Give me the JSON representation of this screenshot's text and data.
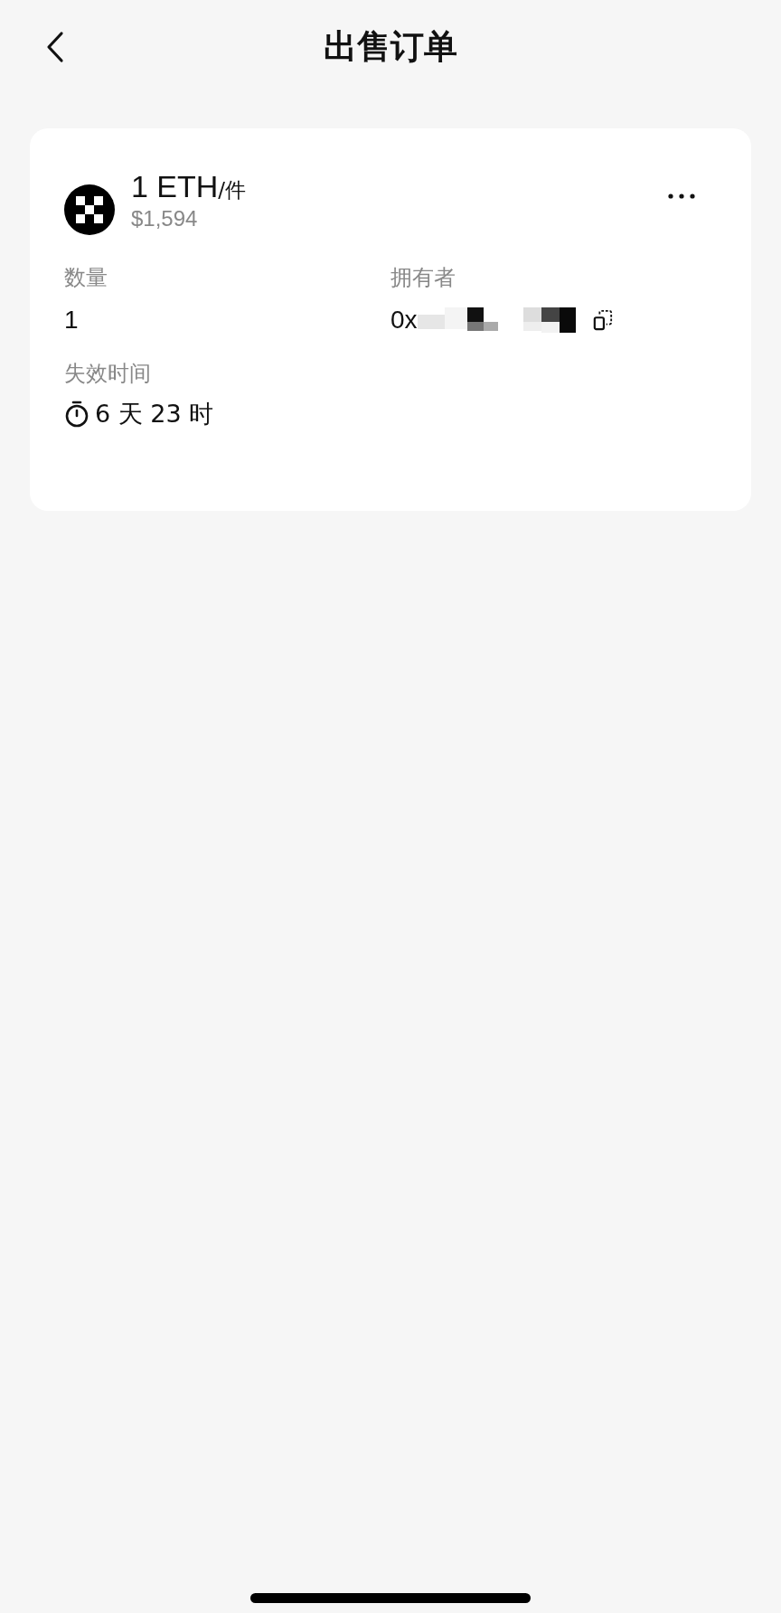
{
  "header": {
    "title": "出售订单"
  },
  "order": {
    "price": "1 ETH",
    "unit": "/件",
    "fiat": "$1,594",
    "fields": [
      {
        "label": "数量",
        "value": "1"
      },
      {
        "label": "拥有者",
        "value": "0x",
        "kind": "address"
      }
    ],
    "expiry": {
      "label": "失效时间",
      "value": "6 天 23 时"
    }
  }
}
